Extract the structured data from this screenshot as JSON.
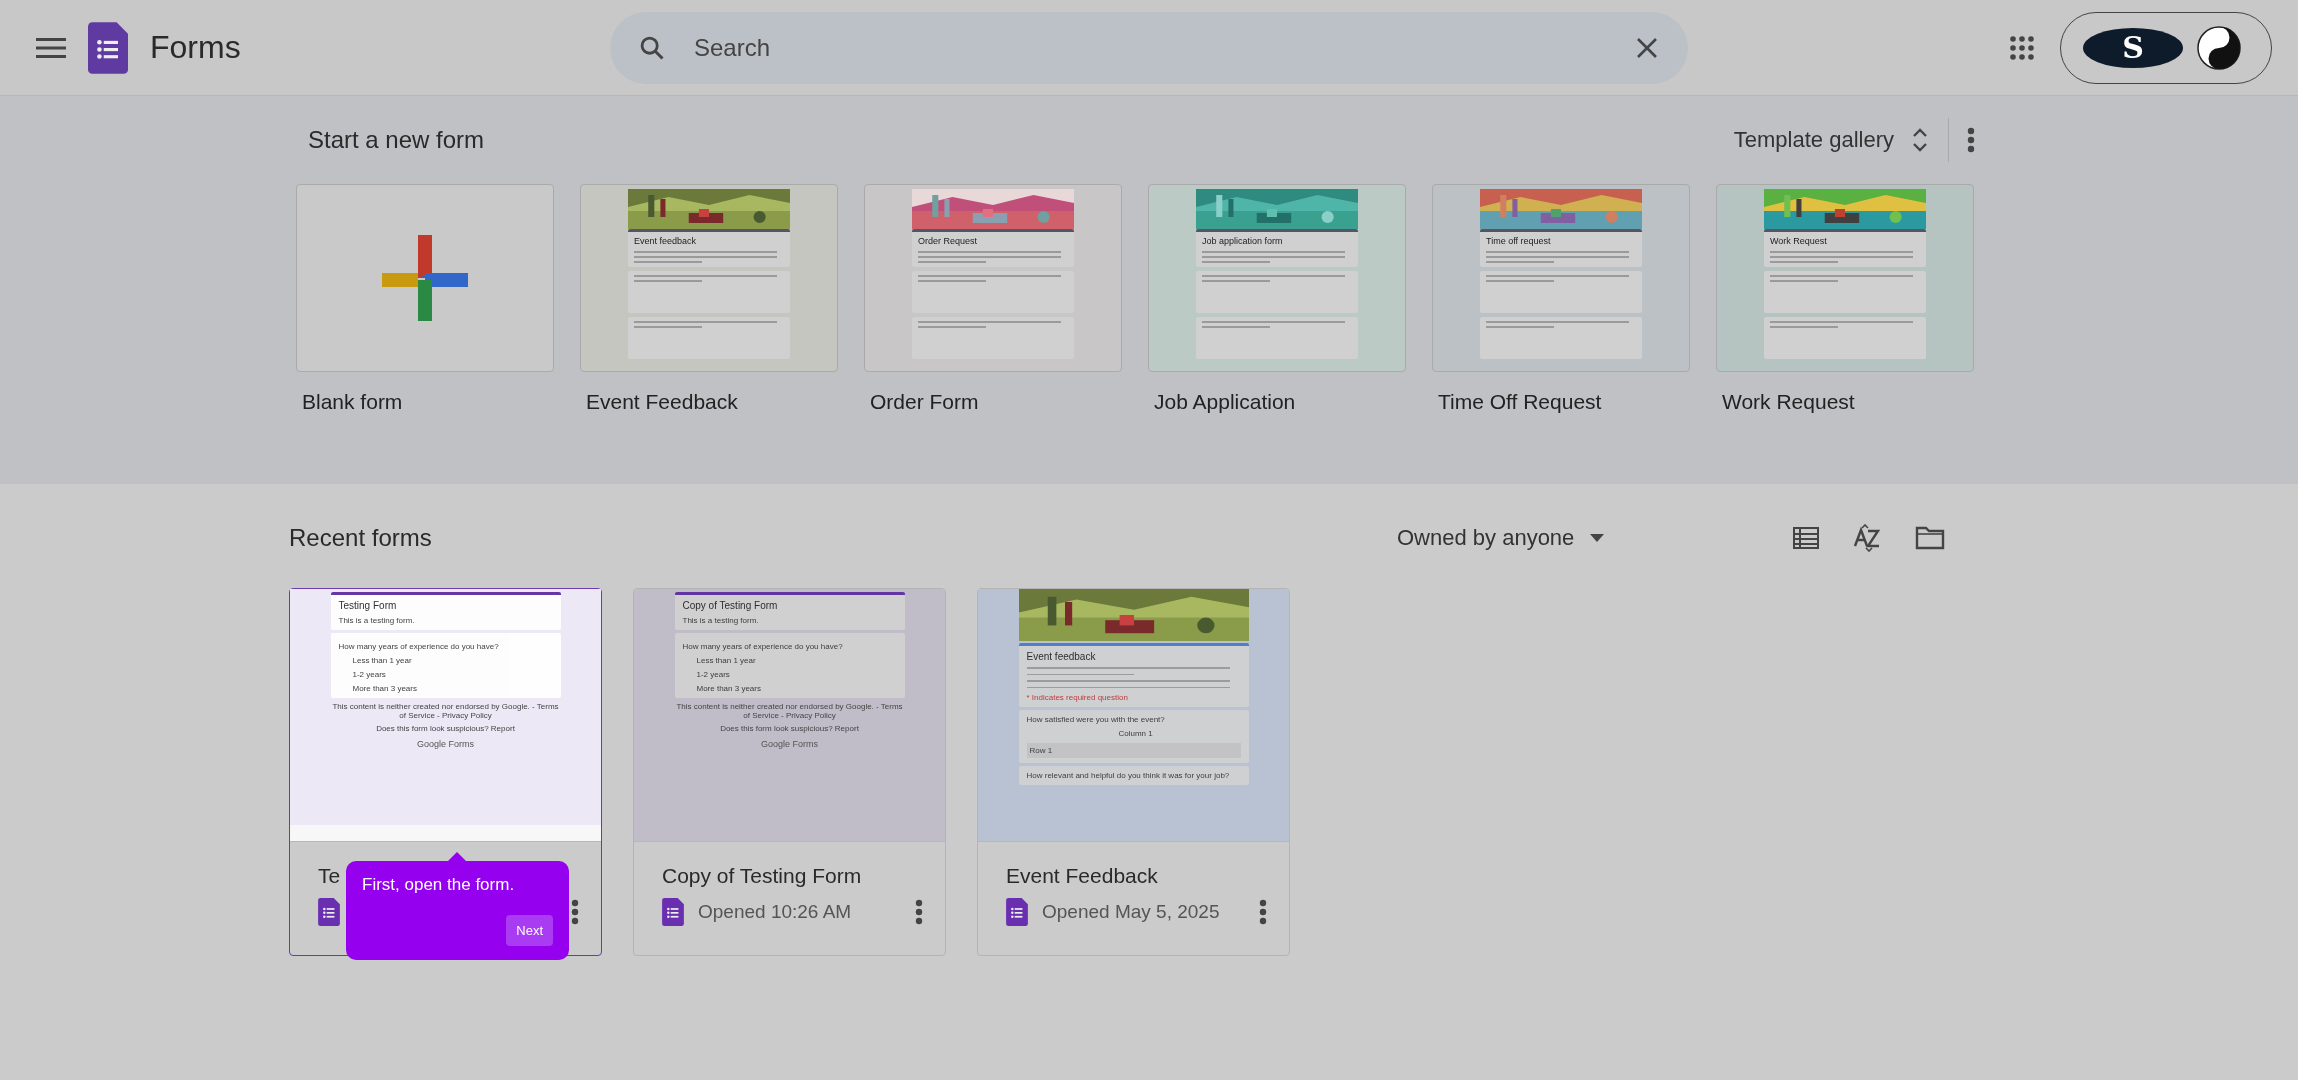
{
  "header": {
    "app_name": "Forms",
    "search": {
      "placeholder": "Search"
    },
    "account_logo": "S"
  },
  "templates": {
    "heading": "Start a new form",
    "gallery_button": "Template gallery",
    "items": [
      {
        "kind": "blank",
        "label": "Blank form"
      },
      {
        "kind": "form",
        "label": "Event Feedback",
        "preview_title": "Event feedback"
      },
      {
        "kind": "form",
        "label": "Order Form",
        "preview_title": "Order Request"
      },
      {
        "kind": "form",
        "label": "Job Application",
        "preview_title": "Job application form"
      },
      {
        "kind": "form",
        "label": "Time Off Request",
        "preview_title": "Time off request"
      },
      {
        "kind": "form",
        "label": "Work Request",
        "preview_title": "Work Request"
      }
    ]
  },
  "recent": {
    "heading": "Recent forms",
    "owner_filter": "Owned by anyone",
    "forms": [
      {
        "kind": "plain",
        "title": "Te",
        "selected": true,
        "preview": {
          "title": "Testing Form",
          "description": "This is a testing form.",
          "question": "How many years of experience do you have?",
          "options": [
            "Less than 1 year",
            "1-2 years",
            "More than 3 years"
          ],
          "footer": [
            "This content is neither created nor endorsed by Google. - Terms of Service - Privacy Policy",
            "Does this form look suspicious? Report"
          ],
          "brand": "Google Forms"
        }
      },
      {
        "kind": "plain",
        "title": "Copy of Testing Form",
        "meta": "Opened 10:26 AM",
        "selected": false,
        "preview": {
          "title": "Copy of Testing Form",
          "description": "This is a testing form.",
          "question": "How many years of experience do you have?",
          "options": [
            "Less than 1 year",
            "1-2 years",
            "More than 3 years"
          ],
          "footer": [
            "This content is neither created nor endorsed by Google. - Terms of Service - Privacy Policy",
            "Does this form look suspicious? Report"
          ],
          "brand": "Google Forms"
        }
      },
      {
        "kind": "banner",
        "title": "Event Feedback",
        "meta": "Opened May 5, 2025",
        "selected": false,
        "preview": {
          "title": "Event feedback",
          "required_note": "* Indicates required question",
          "question": "How satisfied were you with the event?",
          "column": "Column 1",
          "row": "Row 1",
          "next_question": "How relevant and helpful do you think it was for your job?"
        }
      }
    ]
  },
  "tooltip": {
    "text": "First, open the form.",
    "button": "Next"
  }
}
